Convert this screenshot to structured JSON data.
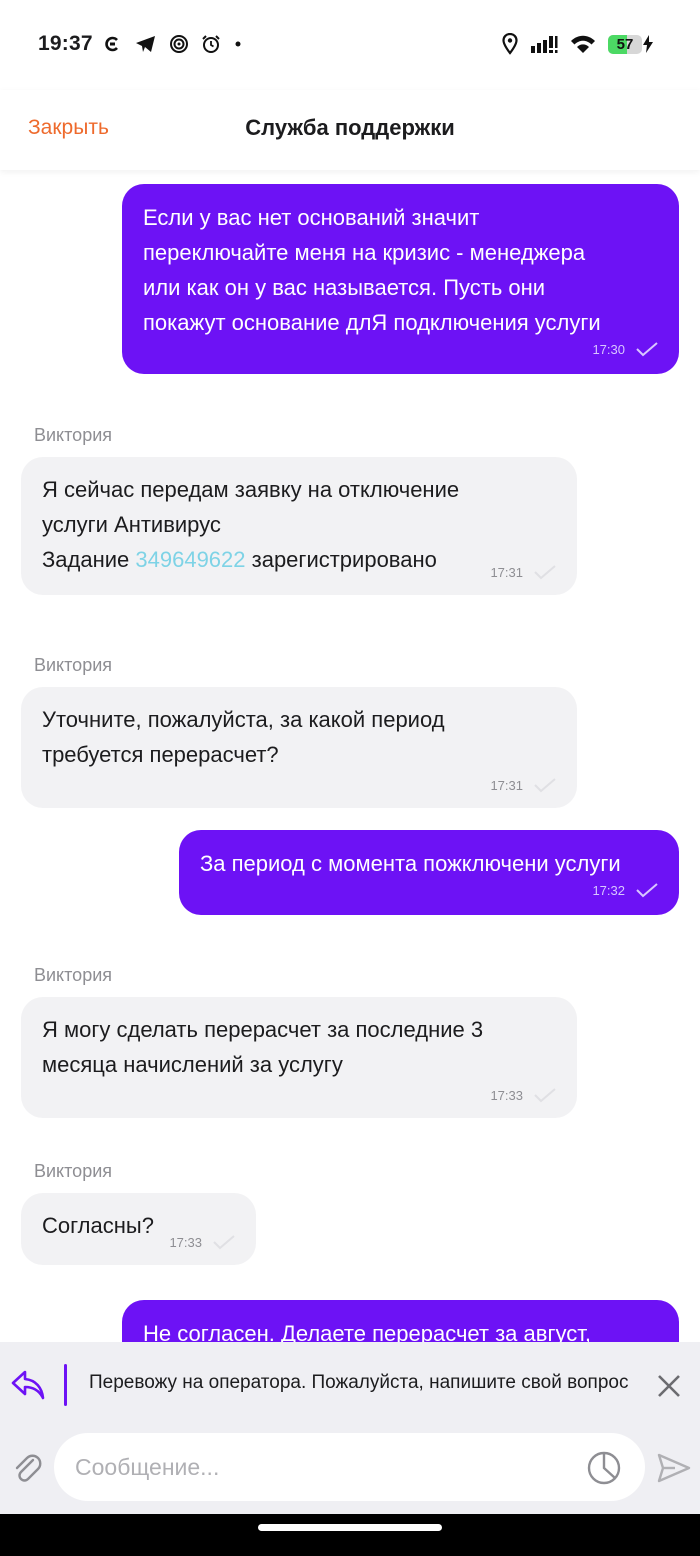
{
  "status_bar": {
    "time": "19:37",
    "battery_level": "57",
    "battery_percent": 57
  },
  "header": {
    "close_label": "Закрыть",
    "title": "Служба поддержки"
  },
  "messages": [
    {
      "direction": "out",
      "text": "Если у вас нет оснований значит\nпереключайте меня на кризис - менеджера\nили как он у вас называется. Пусть они\nпокажут основание длЯ подключения услуги",
      "time": "17:30"
    },
    {
      "direction": "in",
      "sender": "Виктория",
      "text_before": "Я сейчас передам заявку на отключение\nуслуги Антивирус\nЗадание ",
      "link": "349649622",
      "text_after": " зарегистрировано",
      "time": "17:31"
    },
    {
      "direction": "in",
      "sender": "Виктория",
      "text": "Уточните, пожалуйста, за какой период\nтребуется перерасчет?",
      "time": "17:31"
    },
    {
      "direction": "out",
      "text": "За период с момента пожключени услуги",
      "time": "17:32"
    },
    {
      "direction": "in",
      "sender": "Виктория",
      "text": "Я могу сделать перерасчет за последние 3\nмесяца начислений за услугу",
      "time": "17:33"
    },
    {
      "direction": "in",
      "sender": "Виктория",
      "text": "Согласны?",
      "time": "17:33"
    },
    {
      "direction": "out",
      "text": "Не согласен. Делаете перерасчет за август,"
    }
  ],
  "reply_preview": {
    "text": "Перевожу на оператора. Пожалуйста, напишите свой вопрос"
  },
  "composer": {
    "placeholder": "Сообщение...",
    "value": ""
  },
  "colors": {
    "accent_orange": "#ee6a2c",
    "outgoing_bubble": "#6d12f5",
    "incoming_bubble": "#f2f2f4",
    "link": "#7ed3e6"
  }
}
